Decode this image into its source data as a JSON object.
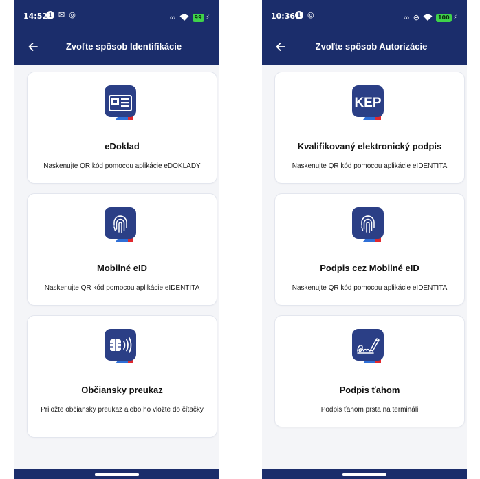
{
  "left_screen": {
    "status": {
      "time": "14:52",
      "battery": "99"
    },
    "title": "Zvoľte spôsob Identifikácie",
    "cards": [
      {
        "title": "eDoklad",
        "description": "Naskenujte QR kód pomocou aplikácie eDOKLADY",
        "icon": "id-card-icon"
      },
      {
        "title": "Mobilné eID",
        "description": "Naskenujte QR kód pomocou aplikácie eIDENTITA",
        "icon": "fingerprint-icon"
      },
      {
        "title": "Občiansky preukaz",
        "description": "Priložte občiansky preukaz alebo ho vložte do čítačky",
        "icon": "contactless-card-icon"
      }
    ]
  },
  "right_screen": {
    "status": {
      "time": "10:36",
      "battery": "100"
    },
    "title": "Zvoľte spôsob Autorizácie",
    "cards": [
      {
        "title": "Kvalifikovaný elektronický podpis",
        "description": "Naskenujte QR kód pomocou aplikácie eIDENTITA",
        "icon": "kep-icon",
        "icon_text": "KEP"
      },
      {
        "title": "Podpis cez Mobilné eID",
        "description": "Naskenujte QR kód pomocou aplikácie eIDENTITA",
        "icon": "fingerprint-icon"
      },
      {
        "title": "Podpis ťahom",
        "description": "Podpis ťahom prsta na termináli",
        "icon": "signature-pen-icon"
      }
    ]
  },
  "colors": {
    "header_navy": "#1b2d6b",
    "icon_navy": "#2b3f86",
    "accent_red": "#e0282e",
    "accent_blue": "#2f6fd6",
    "background": "#f4f5f8",
    "battery_green": "#3fd34a"
  }
}
